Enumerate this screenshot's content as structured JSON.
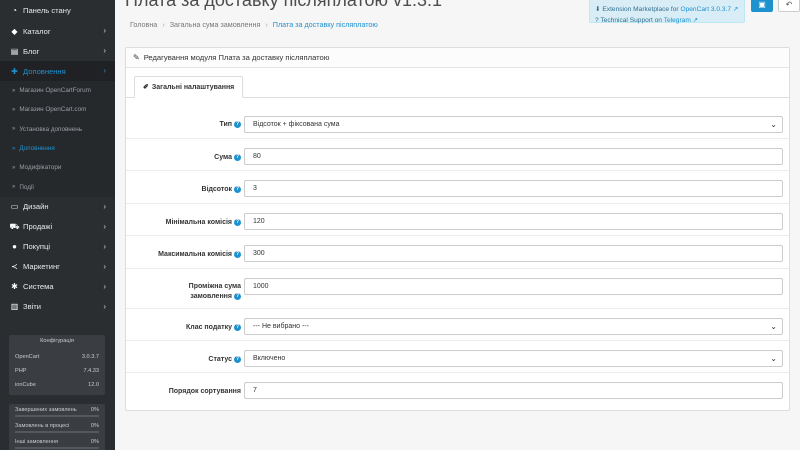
{
  "sidebar": {
    "items": [
      {
        "label": "Панель стану",
        "icon": "dashboard-icon",
        "glyph": "◔"
      },
      {
        "label": "Каталог",
        "icon": "tag-icon",
        "glyph": "◆"
      },
      {
        "label": "Блог",
        "icon": "blog-icon",
        "glyph": "▤"
      },
      {
        "label": "Доповнення",
        "icon": "puzzle-icon",
        "glyph": "✚"
      }
    ],
    "subitems": [
      "Магазин OpenCartForum",
      "Магазин OpenCart.com",
      "Установка доповнень",
      "Доповнення",
      "Модифікатори",
      "Події"
    ],
    "items2": [
      {
        "label": "Дизайн",
        "icon": "desktop-icon",
        "glyph": "▭"
      },
      {
        "label": "Продажі",
        "icon": "cart-icon",
        "glyph": "⛟"
      },
      {
        "label": "Покупці",
        "icon": "user-icon",
        "glyph": "●"
      },
      {
        "label": "Маркетинг",
        "icon": "share-icon",
        "glyph": "≺"
      },
      {
        "label": "Система",
        "icon": "cog-icon",
        "glyph": "✱"
      },
      {
        "label": "Звіти",
        "icon": "bar-chart-icon",
        "glyph": "▥"
      }
    ],
    "stats": {
      "title": "Конфігурація",
      "rows": [
        {
          "name": "OpenCart",
          "value": "3.0.3.7"
        },
        {
          "name": "PHP",
          "value": "7.4.33"
        },
        {
          "name": "ionCube",
          "value": "12.0"
        }
      ]
    },
    "progress": [
      {
        "label": "Завершених замовлень",
        "value": "0%"
      },
      {
        "label": "Замовлень в процесі",
        "value": "0%"
      },
      {
        "label": "Інші замовлення",
        "value": "0%"
      }
    ]
  },
  "header": {
    "title": "Плата за доставку післяплатою v1.3.1",
    "breadcrumb": [
      "Головна",
      "Загальна сума замовлення",
      "Плата за доставку післяплатою"
    ],
    "info_line1_prefix": "Extension Marketplace for ",
    "info_line1_link": "OpenCart 3.0.3.7",
    "info_line2_prefix": "Technical Support on ",
    "info_line2_link": "Telegram"
  },
  "panel": {
    "title": "Редагування модуля Плата за доставку післяплатою",
    "tab": "Загальні налаштування",
    "fields": [
      {
        "label": "Тип",
        "help": true,
        "value": "Відсоток + фіксована сума",
        "type": "select"
      },
      {
        "label": "Сума",
        "help": true,
        "value": "80",
        "type": "input"
      },
      {
        "label": "Відсоток",
        "help": true,
        "value": "3",
        "type": "input"
      },
      {
        "label": "Мінімальна комісія",
        "help": true,
        "value": "120",
        "type": "input"
      },
      {
        "label": "Максимальна комісія",
        "help": true,
        "value": "300",
        "type": "input"
      },
      {
        "label": "Проміжна сума замовлення",
        "help": true,
        "value": "1000",
        "type": "input"
      },
      {
        "label": "Клас податку",
        "help": true,
        "value": "--- Не вибрано ---",
        "type": "select"
      },
      {
        "label": "Статус",
        "help": true,
        "value": "Включено",
        "type": "select"
      },
      {
        "label": "Порядок сортування",
        "help": false,
        "value": "7",
        "type": "input"
      }
    ]
  }
}
